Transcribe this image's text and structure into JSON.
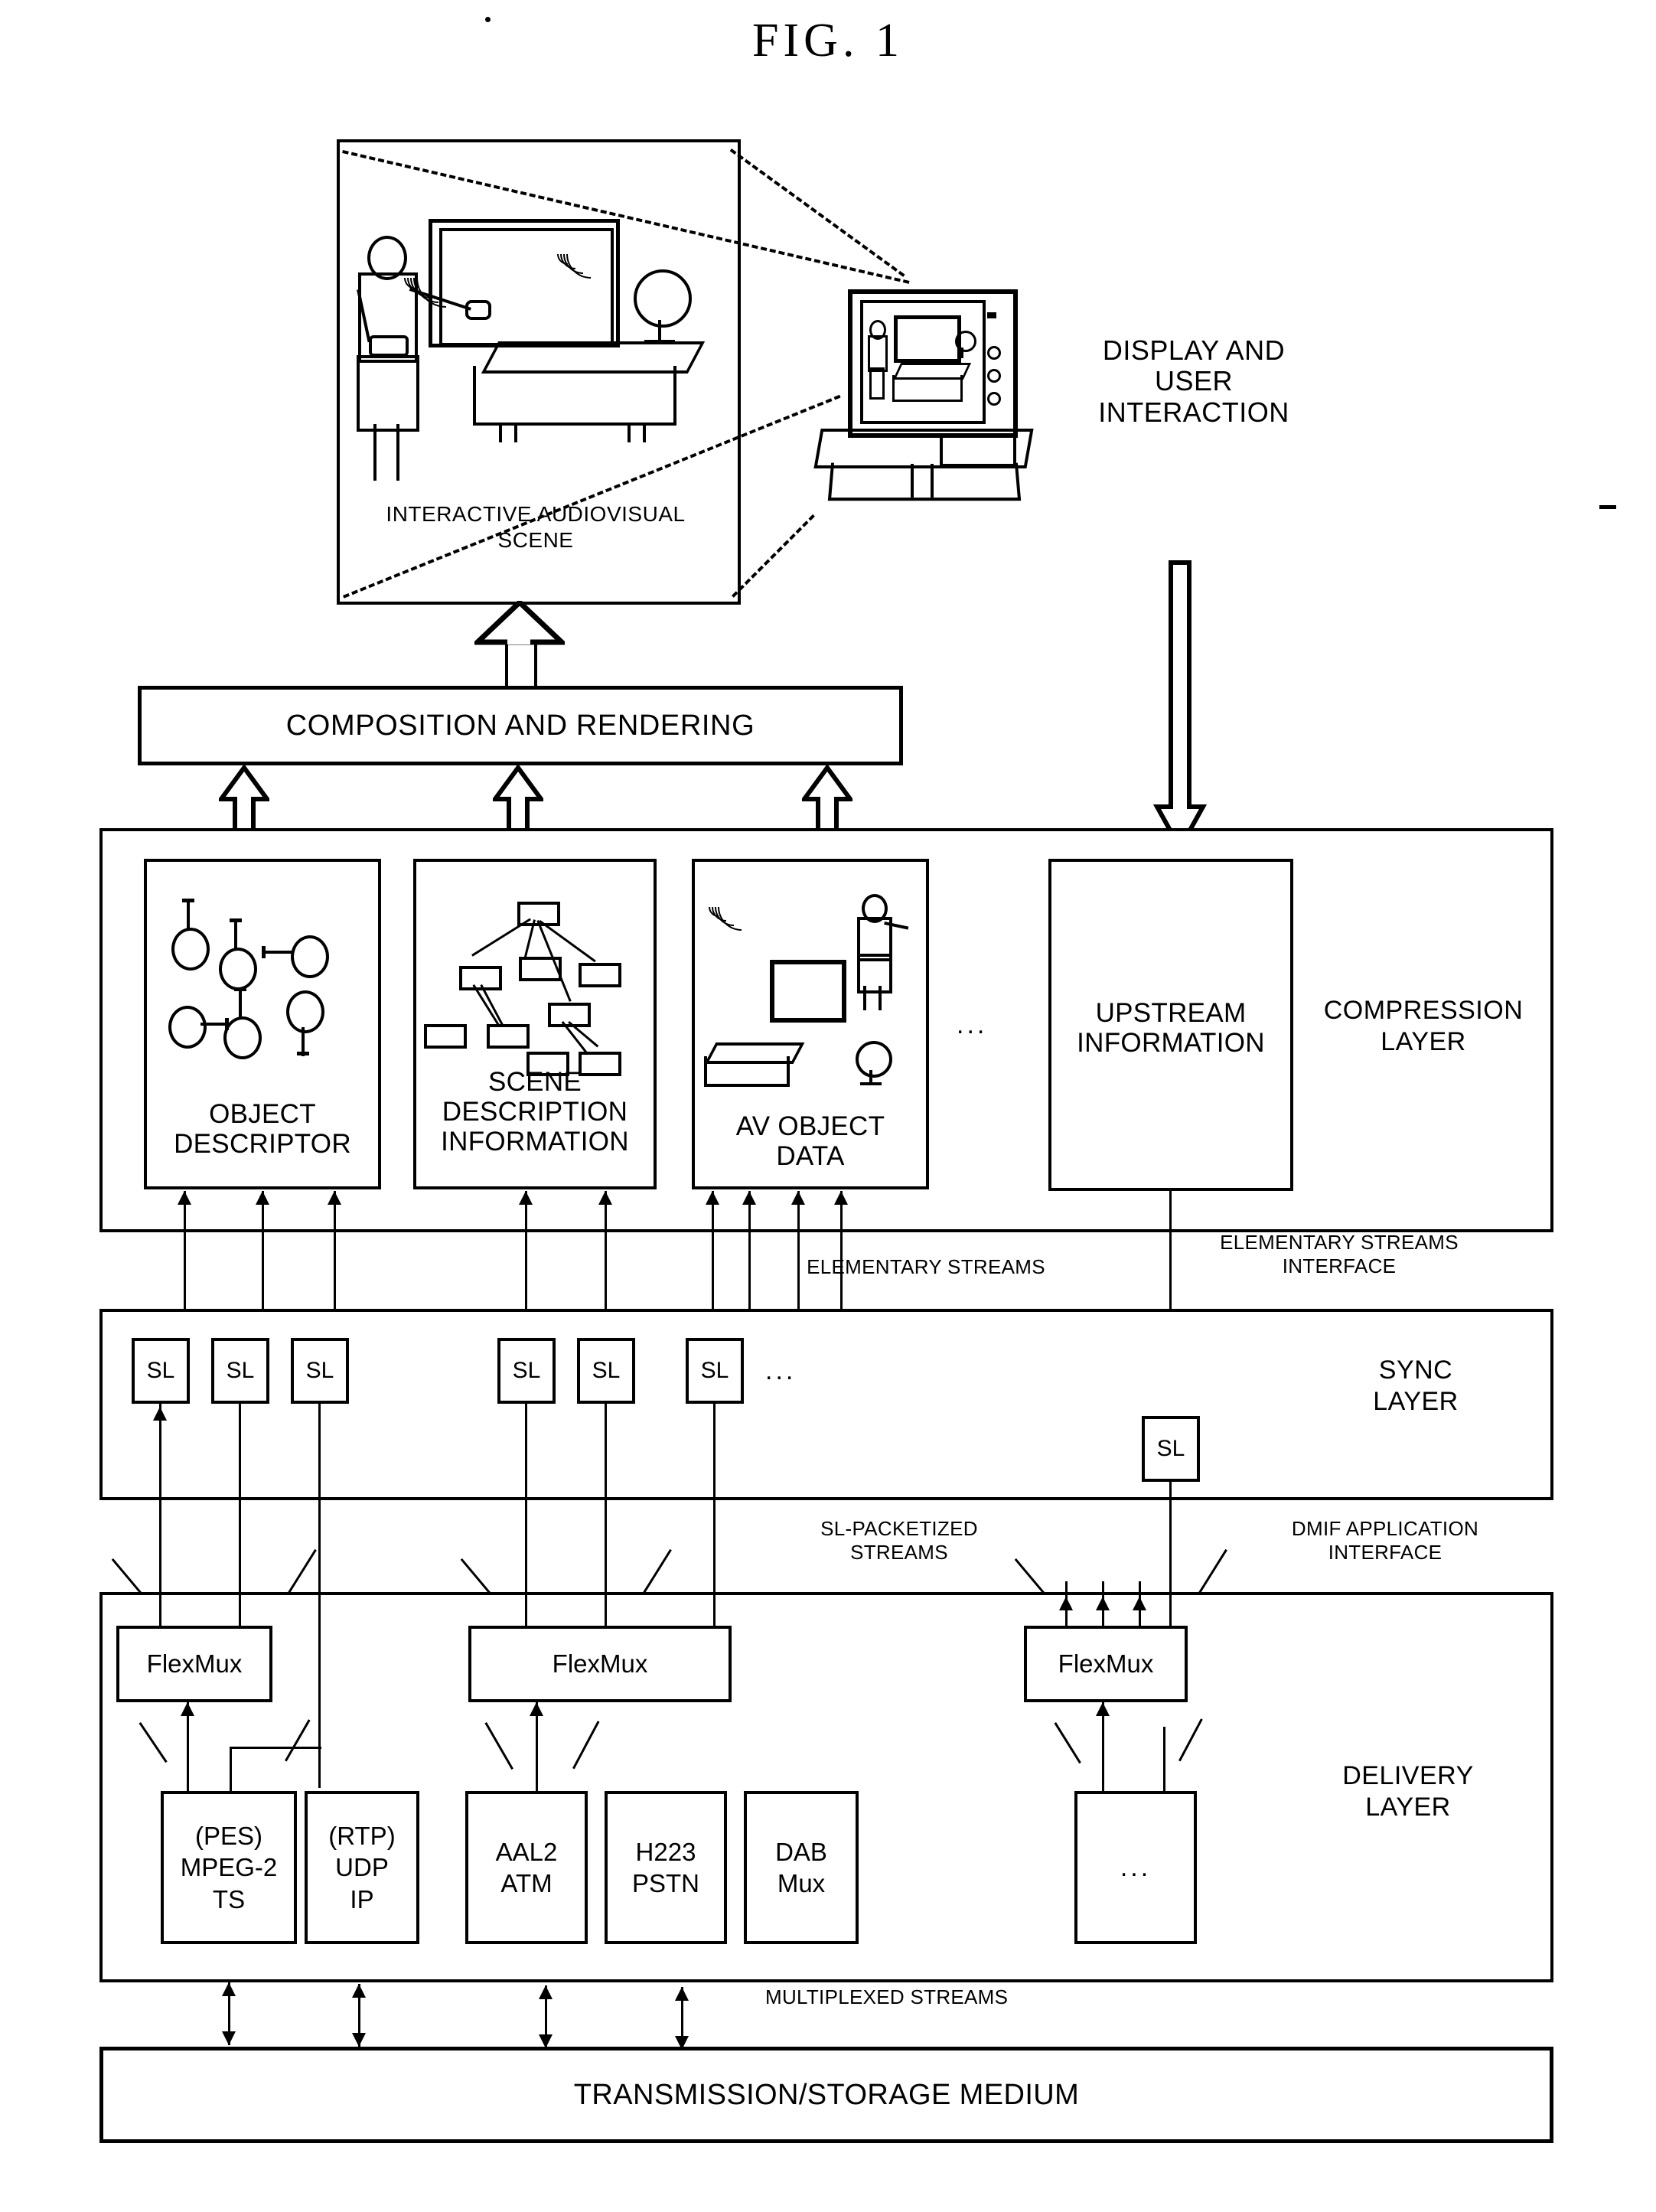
{
  "figure": {
    "title": "FIG.  1"
  },
  "scene": {
    "caption_line1": "INTERACTIVE AUDIOVISUAL",
    "caption_line2": "SCENE",
    "display_label_line1": "DISPLAY AND",
    "display_label_line2": "USER",
    "display_label_line3": "INTERACTION"
  },
  "composition": {
    "label": "COMPOSITION AND RENDERING"
  },
  "compression_layer": {
    "layer_label_line1": "COMPRESSION",
    "layer_label_line2": "LAYER",
    "ellipsis": "...",
    "boxes": [
      {
        "name": "object-descriptor",
        "line1": "OBJECT",
        "line2": "DESCRIPTOR"
      },
      {
        "name": "scene-description-information",
        "line1": "SCENE",
        "line2": "DESCRIPTION",
        "line3": "INFORMATION"
      },
      {
        "name": "av-object-data",
        "line1": "AV OBJECT",
        "line2": "DATA"
      },
      {
        "name": "upstream-information",
        "line1": "UPSTREAM",
        "line2": "INFORMATION"
      }
    ]
  },
  "elementary_streams": {
    "label": "ELEMENTARY STREAMS",
    "interface_line1": "ELEMENTARY STREAMS",
    "interface_line2": "INTERFACE"
  },
  "sync_layer": {
    "layer_label_line1": "SYNC",
    "layer_label_line2": "LAYER",
    "sl_label": "SL",
    "ellipsis": "...",
    "sl_count_left": 3,
    "sl_count_mid": 3,
    "sl_count_upstream": 1
  },
  "sl_packetized": {
    "label_line1": "SL-PACKETIZED",
    "label_line2": "STREAMS",
    "interface_line1": "DMIF APPLICATION",
    "interface_line2": "INTERFACE"
  },
  "delivery_layer": {
    "layer_label_line1": "DELIVERY",
    "layer_label_line2": "LAYER",
    "flexmux_label": "FlexMux",
    "flexmux_count": 3,
    "boxes": [
      {
        "name": "pes-mpeg2-ts",
        "line1": "(PES)",
        "line2": "MPEG-2",
        "line3": "TS"
      },
      {
        "name": "rtp-udp-ip",
        "line1": "(RTP)",
        "line2": "UDP",
        "line3": "IP"
      },
      {
        "name": "aal2-atm",
        "line1": "AAL2",
        "line2": "ATM"
      },
      {
        "name": "h223-pstn",
        "line1": "H223",
        "line2": "PSTN"
      },
      {
        "name": "dab-mux",
        "line1": "DAB",
        "line2": "Mux"
      },
      {
        "name": "other-delivery",
        "line1": "..."
      }
    ]
  },
  "multiplexed_streams": {
    "label": "MULTIPLEXED STREAMS"
  },
  "transmission_medium": {
    "label": "TRANSMISSION/STORAGE MEDIUM"
  }
}
